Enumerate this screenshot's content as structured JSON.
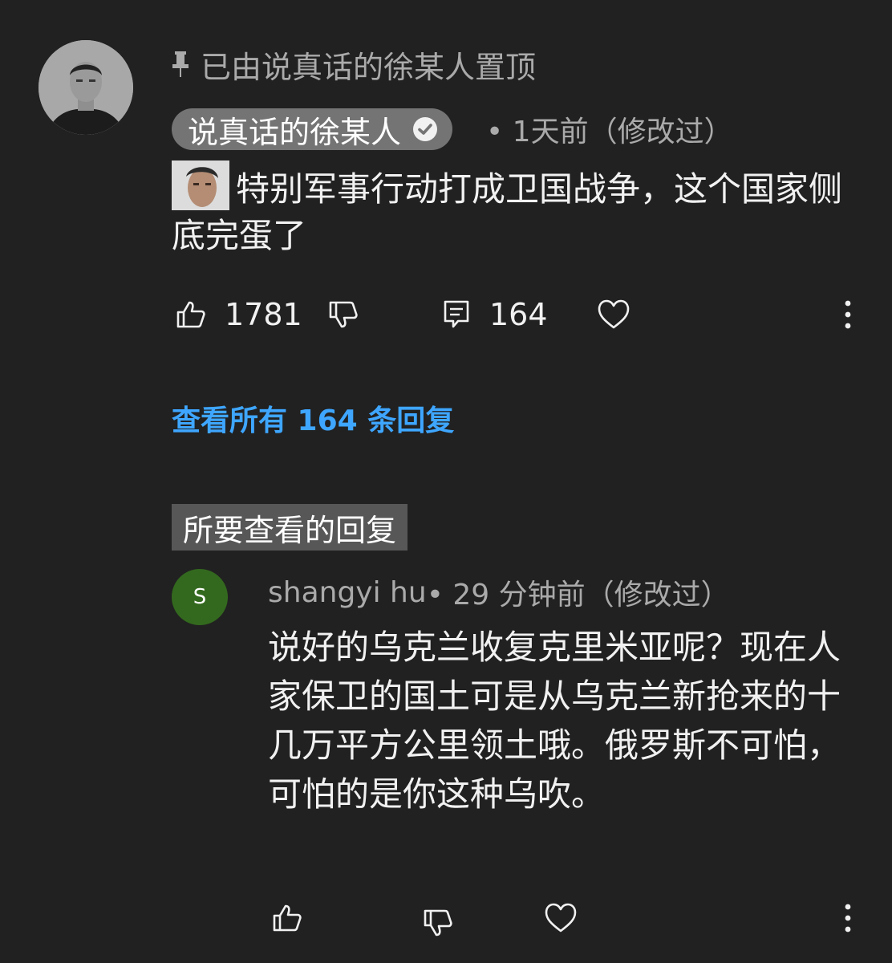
{
  "pinned": {
    "icon": "pin-icon",
    "label": "已由说真话的徐某人置顶"
  },
  "comment": {
    "author": "说真话的徐某人",
    "verified_icon": "verified-check-icon",
    "meta": "• 1天前（修改过）",
    "text": "特别军事行动打成卫国战争，这个国家侧底完蛋了",
    "likes": "1781",
    "replies_count": "164",
    "view_replies": "查看所有 164 条回复"
  },
  "reply_section": {
    "label": "所要查看的回复"
  },
  "reply": {
    "avatar_letter": "S",
    "author": "shangyi hu",
    "meta": " • 29 分钟前（修改过）",
    "text": "说好的乌克兰收复克里米亚呢？现在人家保卫的国土可是从乌克兰新抢来的十几万平方公里领土哦。俄罗斯不可怕，可怕的是你这种乌吹。"
  },
  "colors": {
    "background": "#212121",
    "link": "#3ea6ff",
    "reply_avatar": "#33691e",
    "muted_text": "#aaaaaa"
  }
}
